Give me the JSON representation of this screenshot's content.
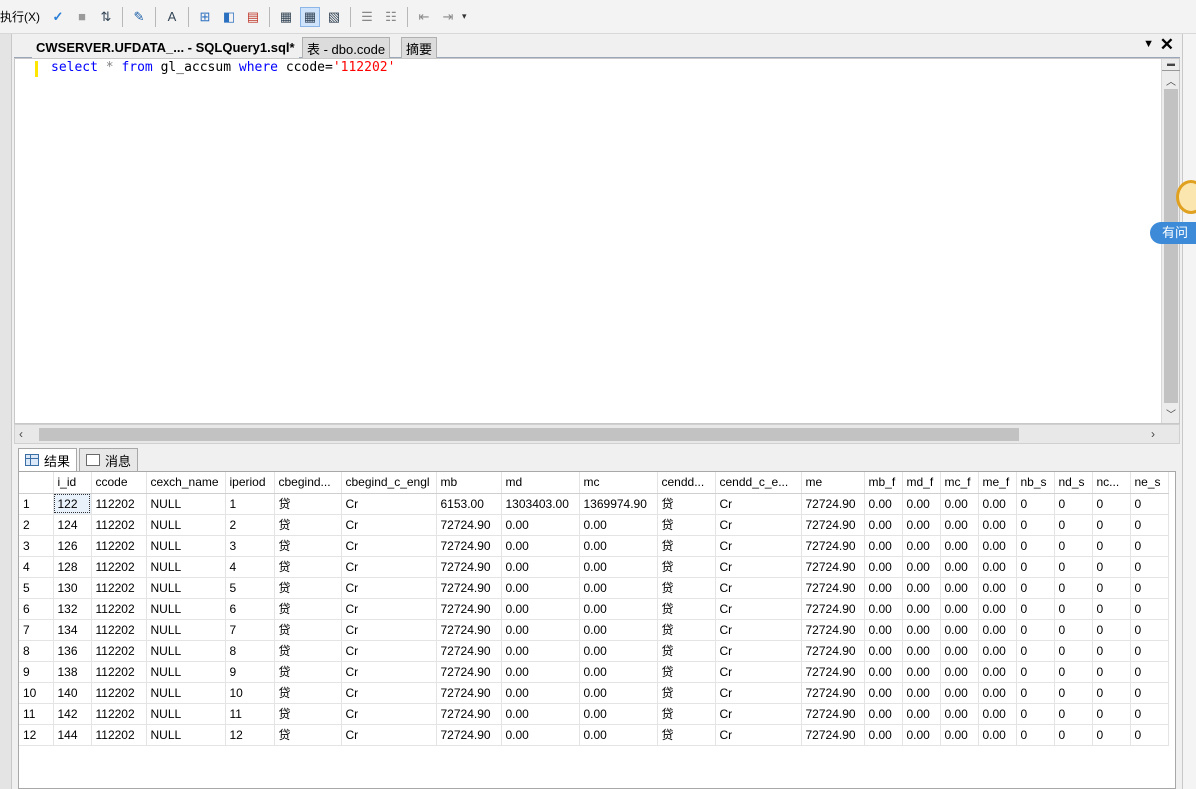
{
  "toolbar": {
    "execute_label": "执行(X)",
    "icons": [
      "check-icon",
      "stop-icon",
      "debug-icon",
      "parse-icon",
      "format-icon",
      "query-design-icon",
      "include-plan-icon",
      "results-text-icon",
      "results-grid-icon",
      "results-file-icon",
      "comment-icon",
      "uncomment-icon",
      "indent-icon",
      "outdent-icon"
    ]
  },
  "tabs": {
    "active": "CWSERVER.UFDATA_... - SQLQuery1.sql*",
    "second": "表 - dbo.code",
    "third": "摘要",
    "dropdown_glyph": "▼",
    "close_glyph": "✕"
  },
  "editor": {
    "tokens": {
      "select": "select",
      "star": "*",
      "from": "from",
      "table": "gl_accsum",
      "where": "where",
      "field": "ccode=",
      "value": "'112202'"
    }
  },
  "result_tabs": {
    "results": "结果",
    "messages": "消息"
  },
  "grid": {
    "columns": [
      "",
      "i_id",
      "ccode",
      "cexch_name",
      "iperiod",
      "cbegind...",
      "cbegind_c_engl",
      "mb",
      "md",
      "mc",
      "cendd...",
      "cendd_c_e...",
      "me",
      "mb_f",
      "md_f",
      "mc_f",
      "me_f",
      "nb_s",
      "nd_s",
      "nc...",
      "ne_s"
    ],
    "rows": [
      [
        "1",
        "122",
        "112202",
        "NULL",
        "1",
        "贷",
        "Cr",
        "6153.00",
        "1303403.00",
        "1369974.90",
        "贷",
        "Cr",
        "72724.90",
        "0.00",
        "0.00",
        "0.00",
        "0.00",
        "0",
        "0",
        "0",
        "0"
      ],
      [
        "2",
        "124",
        "112202",
        "NULL",
        "2",
        "贷",
        "Cr",
        "72724.90",
        "0.00",
        "0.00",
        "贷",
        "Cr",
        "72724.90",
        "0.00",
        "0.00",
        "0.00",
        "0.00",
        "0",
        "0",
        "0",
        "0"
      ],
      [
        "3",
        "126",
        "112202",
        "NULL",
        "3",
        "贷",
        "Cr",
        "72724.90",
        "0.00",
        "0.00",
        "贷",
        "Cr",
        "72724.90",
        "0.00",
        "0.00",
        "0.00",
        "0.00",
        "0",
        "0",
        "0",
        "0"
      ],
      [
        "4",
        "128",
        "112202",
        "NULL",
        "4",
        "贷",
        "Cr",
        "72724.90",
        "0.00",
        "0.00",
        "贷",
        "Cr",
        "72724.90",
        "0.00",
        "0.00",
        "0.00",
        "0.00",
        "0",
        "0",
        "0",
        "0"
      ],
      [
        "5",
        "130",
        "112202",
        "NULL",
        "5",
        "贷",
        "Cr",
        "72724.90",
        "0.00",
        "0.00",
        "贷",
        "Cr",
        "72724.90",
        "0.00",
        "0.00",
        "0.00",
        "0.00",
        "0",
        "0",
        "0",
        "0"
      ],
      [
        "6",
        "132",
        "112202",
        "NULL",
        "6",
        "贷",
        "Cr",
        "72724.90",
        "0.00",
        "0.00",
        "贷",
        "Cr",
        "72724.90",
        "0.00",
        "0.00",
        "0.00",
        "0.00",
        "0",
        "0",
        "0",
        "0"
      ],
      [
        "7",
        "134",
        "112202",
        "NULL",
        "7",
        "贷",
        "Cr",
        "72724.90",
        "0.00",
        "0.00",
        "贷",
        "Cr",
        "72724.90",
        "0.00",
        "0.00",
        "0.00",
        "0.00",
        "0",
        "0",
        "0",
        "0"
      ],
      [
        "8",
        "136",
        "112202",
        "NULL",
        "8",
        "贷",
        "Cr",
        "72724.90",
        "0.00",
        "0.00",
        "贷",
        "Cr",
        "72724.90",
        "0.00",
        "0.00",
        "0.00",
        "0.00",
        "0",
        "0",
        "0",
        "0"
      ],
      [
        "9",
        "138",
        "112202",
        "NULL",
        "9",
        "贷",
        "Cr",
        "72724.90",
        "0.00",
        "0.00",
        "贷",
        "Cr",
        "72724.90",
        "0.00",
        "0.00",
        "0.00",
        "0.00",
        "0",
        "0",
        "0",
        "0"
      ],
      [
        "10",
        "140",
        "112202",
        "NULL",
        "10",
        "贷",
        "Cr",
        "72724.90",
        "0.00",
        "0.00",
        "贷",
        "Cr",
        "72724.90",
        "0.00",
        "0.00",
        "0.00",
        "0.00",
        "0",
        "0",
        "0",
        "0"
      ],
      [
        "11",
        "142",
        "112202",
        "NULL",
        "11",
        "贷",
        "Cr",
        "72724.90",
        "0.00",
        "0.00",
        "贷",
        "Cr",
        "72724.90",
        "0.00",
        "0.00",
        "0.00",
        "0.00",
        "0",
        "0",
        "0",
        "0"
      ],
      [
        "12",
        "144",
        "112202",
        "NULL",
        "12",
        "贷",
        "Cr",
        "72724.90",
        "0.00",
        "0.00",
        "贷",
        "Cr",
        "72724.90",
        "0.00",
        "0.00",
        "0.00",
        "0.00",
        "0",
        "0",
        "0",
        "0"
      ]
    ]
  },
  "side": {
    "help_label": "有问"
  }
}
